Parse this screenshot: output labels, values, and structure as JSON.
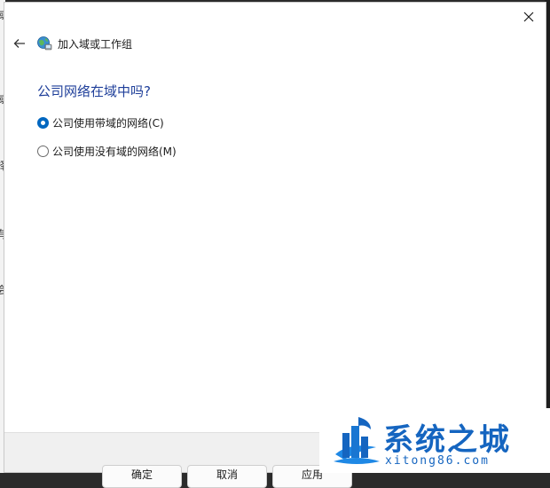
{
  "window": {
    "title": "加入域或工作组"
  },
  "page": {
    "question": "公司网络在域中吗?",
    "options": [
      {
        "label": "公司使用带域的网络(C)",
        "selected": true
      },
      {
        "label": "公司使用没有域的网络(M)",
        "selected": false
      }
    ]
  },
  "footer": {
    "buttons": [
      "确定",
      "取消",
      "应用"
    ]
  },
  "background": {
    "left_edge_chars": [
      "域",
      "择",
      "有",
      "会"
    ]
  },
  "watermark": {
    "title": "系统之城",
    "url": "xitong86.com"
  },
  "colors": {
    "accent": "#0067c0",
    "question_text": "#1f3f9a",
    "watermark": "#1565c0"
  },
  "icons": {
    "close": "close-icon",
    "back": "back-arrow-icon",
    "app": "network-globe-icon"
  }
}
